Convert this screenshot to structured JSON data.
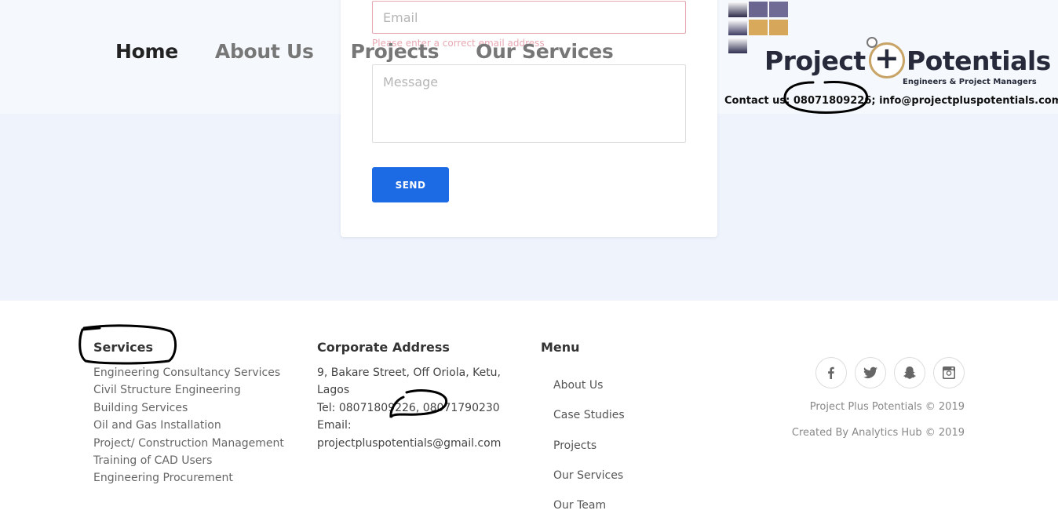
{
  "nav": {
    "items": [
      {
        "label": "Home",
        "active": true
      },
      {
        "label": "About Us",
        "active": false
      },
      {
        "label": "Projects",
        "active": false
      },
      {
        "label": "Our Services",
        "active": false
      }
    ]
  },
  "contact_form": {
    "email_placeholder": "Email",
    "email_error": "Please enter a correct email address",
    "message_placeholder": "Message",
    "send_label": "SEND"
  },
  "logo": {
    "word1": "Project",
    "word2": "Potentials",
    "tagline": "Engineers & Project Managers",
    "contact_line": "Contact us: 08071809226; info@projectpluspotentials.com",
    "tile_colors": [
      "#2c2b4a",
      "#6a6690",
      "#6f6b95",
      "#3f3d63",
      "#d9a95b",
      "#d6a65a",
      "#2f2e50"
    ]
  },
  "footer": {
    "services": {
      "heading": "Services",
      "items": [
        "Engineering Consultancy Services",
        "Civil Structure Engineering",
        "Building Services",
        "Oil and Gas Installation",
        "Project/ Construction Management",
        "Training of CAD Users",
        "Engineering Procurement"
      ]
    },
    "address": {
      "heading": "Corporate Address",
      "line1": "9, Bakare Street, Off Oriola, Ketu,",
      "line2": "Lagos",
      "tel": "Tel: 08071809226, 08071790230",
      "email_label": "Email:",
      "email": "projectpluspotentials@gmail.com"
    },
    "menu": {
      "heading": "Menu",
      "items": [
        "About Us",
        "Case Studies",
        "Projects",
        "Our Services",
        "Our Team"
      ]
    },
    "social_icons": [
      "facebook-icon",
      "twitter-icon",
      "snapchat-icon",
      "instagram-icon"
    ],
    "copyright": "Project Plus Potentials © 2019",
    "created_by": "Created By Analytics Hub © 2019"
  },
  "colors": {
    "accent": "#1c6ae4",
    "logo_gold": "#c8a466",
    "logo_navy": "#262a3a"
  }
}
